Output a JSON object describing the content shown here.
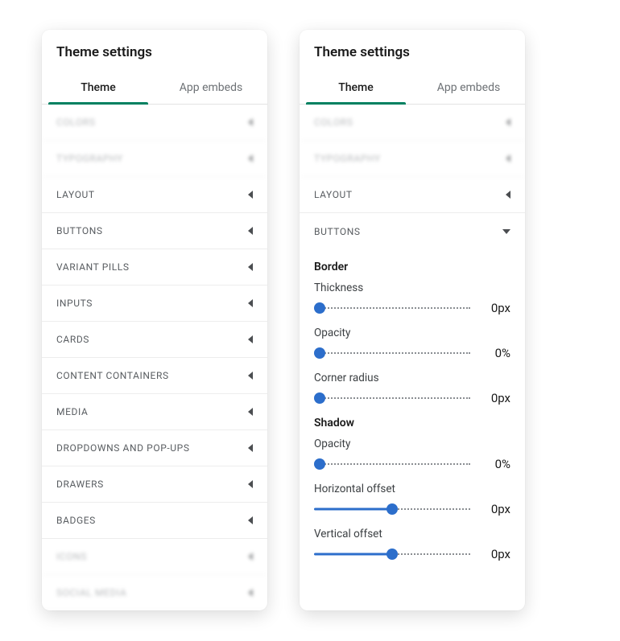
{
  "left": {
    "title": "Theme settings",
    "tabs": {
      "theme": "Theme",
      "embeds": "App embeds"
    },
    "rows": {
      "colors": "COLORS",
      "typography": "TYPOGRAPHY",
      "layout": "LAYOUT",
      "buttons": "BUTTONS",
      "variant_pills": "VARIANT PILLS",
      "inputs": "INPUTS",
      "cards": "CARDS",
      "content_containers": "CONTENT CONTAINERS",
      "media": "MEDIA",
      "dropdowns": "DROPDOWNS AND POP-UPS",
      "drawers": "DRAWERS",
      "badges": "BADGES",
      "icons": "ICONS",
      "social_media": "SOCIAL MEDIA"
    }
  },
  "right": {
    "title": "Theme settings",
    "tabs": {
      "theme": "Theme",
      "embeds": "App embeds"
    },
    "rows": {
      "colors": "COLORS",
      "typography": "TYPOGRAPHY",
      "layout": "LAYOUT",
      "buttons": "BUTTONS"
    },
    "buttons_panel": {
      "border_title": "Border",
      "thickness": {
        "label": "Thickness",
        "value": "0px"
      },
      "opacity": {
        "label": "Opacity",
        "value": "0%"
      },
      "radius": {
        "label": "Corner radius",
        "value": "0px"
      },
      "shadow_title": "Shadow",
      "s_opacity": {
        "label": "Opacity",
        "value": "0%"
      },
      "h_offset": {
        "label": "Horizontal offset",
        "value": "0px"
      },
      "v_offset": {
        "label": "Vertical offset",
        "value": "0px"
      }
    }
  }
}
